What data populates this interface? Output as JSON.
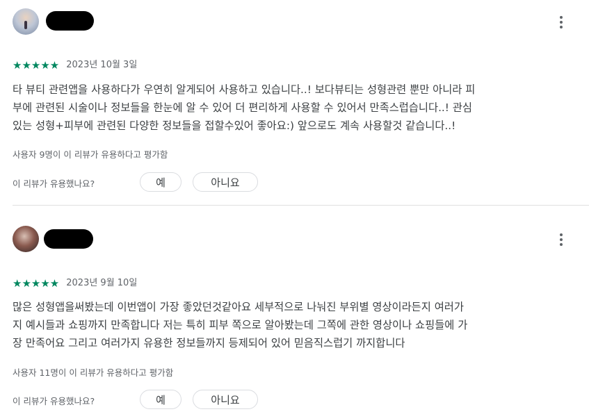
{
  "reviews": [
    {
      "rating_stars": "★★★★★",
      "date": "2023년 10월 3일",
      "body_lines": [
        "타 뷰티 관련앱을 사용하다가 우연히 알게되어 사용하고 있습니다..! 보다뷰티는 성형관련 뿐만 아니라 피",
        "부에 관련된 시술이나 정보들을 한눈에 알 수 있어 더 편리하게 사용할 수 있어서 만족스럽습니다..! 관심",
        "있는 성형+피부에 관련된 다양한 정보들을 접할수있어 좋아요:) 앞으로도 계속 사용할것 같습니다..!"
      ],
      "helpful_text": "사용자 9명이 이 리뷰가 유용하다고 평가함",
      "question": "이 리뷰가 유용했나요?",
      "yes_label": "예",
      "no_label": "아니요"
    },
    {
      "rating_stars": "★★★★★",
      "date": "2023년 9월 10일",
      "body_lines": [
        "많은 성형앱을써봤는데 이번앱이 가장 좋았던것같아요 세부적으로 나눠진 부위별 영상이라든지 여러가",
        "지 예시들과 쇼핑까지 만족합니다 저는 특히 피부 쪽으로 알아봤는데 그쪽에 관한 영상이나 쇼핑들에 가",
        "장 만족어요 그리고 여러가지 유용한 정보들까지 등제되어 있어 믿음직스럽기 까지합니다"
      ],
      "helpful_text": "사용자 11명이 이 리뷰가 유용하다고 평가함",
      "question": "이 리뷰가 유용했나요?",
      "yes_label": "예",
      "no_label": "아니요"
    }
  ],
  "colors": {
    "star": "#01875f",
    "text": "#3c4043",
    "muted": "#5f6368"
  },
  "icons": {
    "more": "more-vert-icon"
  }
}
